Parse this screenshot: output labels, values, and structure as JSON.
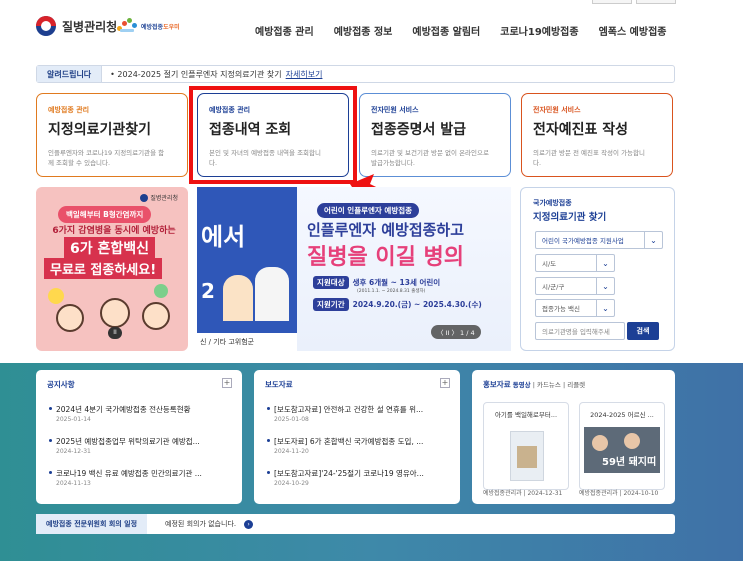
{
  "header": {
    "logo_text": "질병관리청",
    "sublogo_text_1": "예방접종",
    "sublogo_text_2": "도우미",
    "nav": [
      "예방접종 관리",
      "예방접종 정보",
      "예방접종 알림터",
      "코로나19예방접종",
      "엠폭스 예방접종"
    ]
  },
  "notice": {
    "tag": "알려드립니다",
    "text": "• 2024-2025 절기 인플루엔자 지정의료기관 찾기",
    "link": "자세히보기"
  },
  "cards": [
    {
      "category": "예방접종 관리",
      "title": "지정의료기관찾기",
      "desc": "인플루엔자와 코로나19 지정의료기관을 함께 조회할 수 있습니다.",
      "color": "#e07a1f"
    },
    {
      "category": "예방접종 관리",
      "title": "접종내역 조회",
      "desc": "본인 및 자녀의 예방접종 내역을 조회합니다.",
      "color": "#1c3f95"
    },
    {
      "category": "전자민원 서비스",
      "title": "접종증명서 발급",
      "desc": "의료기관 및 보건기관 방문 없이 온라인으로 발급가능합니다.",
      "color": "#1c3f95"
    },
    {
      "category": "전자민원 서비스",
      "title": "전자예진표 작성",
      "desc": "의료기관 방문 전 예진표 작성이 가능합니다.",
      "color": "#d9531e"
    }
  ],
  "banner1": {
    "brand": "질병관리청",
    "badge": "백일해부터 B형간염까지",
    "line1": "6가지 감염병을 동시에 예방하는",
    "line2": "6가 혼합백신",
    "line3": "무료로 접종하세요!",
    "pause": "II"
  },
  "banner2": {
    "left_text": "에서",
    "left_num": "2",
    "footer": "신 / 기타 고위험군",
    "tag": "어린이 인플루엔자 예방접종",
    "head1": "인플루엔자 예방접종하고",
    "head2": "질병을 이길 병의",
    "target_label": "지원대상",
    "target": "생후 6개월 ~ 13세 어린이",
    "target_sub": "(2011.1.1. ~ 2024.8.31 출생자)",
    "period_label": "지원기간",
    "period": "2024.9.20.(금) ~ 2025.4.30.(수)",
    "pager": "〈 II 〉 1 / 4"
  },
  "finder": {
    "sub": "국가예방접종",
    "title": "지정의료기관 찾기",
    "program": "어린이 국가예방접종 지원사업",
    "city": "시/도",
    "district": "시/군/구",
    "vaccine": "접종가능 백신",
    "search_placeholder": "의료기관명을 입력해주세",
    "search_button": "검색"
  },
  "notices_panel": {
    "title": "공지사항",
    "plus": "+",
    "items": [
      {
        "text": "2024년 4분기 국가예방접종 전산등록현황",
        "date": "2025-01-14"
      },
      {
        "text": "2025년 예방접종업무 위탁의료기관 예방접...",
        "date": "2024-12-31"
      },
      {
        "text": "코로나19 백신 유료 예방접종 민간의료기관 ...",
        "date": "2024-11-13"
      }
    ]
  },
  "press_panel": {
    "title": "보도자료",
    "plus": "+",
    "items": [
      {
        "text": "[보도참고자료] 안전하고 건강한 설 연휴를 위...",
        "date": "2025-01-08"
      },
      {
        "text": "[보도자료] 6가 혼합백신 국가예방접종 도입, ...",
        "date": "2024-11-20"
      },
      {
        "text": "[보도참고자료]'24-'25절기 코로나19 영유아...",
        "date": "2024-10-29"
      }
    ]
  },
  "promo_panel": {
    "title": "홍보자료",
    "tab_active": "동영상",
    "tab_2": "카드뉴스",
    "tab_3": "리플렛",
    "items": [
      {
        "title": "아기를 백일해로부터...",
        "caption": "예방접종관리과 | 2024-12-31"
      },
      {
        "title": "2024-2025 어르신 ...",
        "caption": "예방접종관리과 | 2024-10-10",
        "overlay": "59년 돼지띠"
      }
    ]
  },
  "meeting": {
    "tag": "예방접종 전문위원회 회의 일정",
    "text": "예정된 회의가 없습니다.",
    "icon": "›"
  },
  "colors": {
    "primary": "#1c3f95",
    "highlight": "#ee1111",
    "teal_bg": "#3e89a9"
  }
}
